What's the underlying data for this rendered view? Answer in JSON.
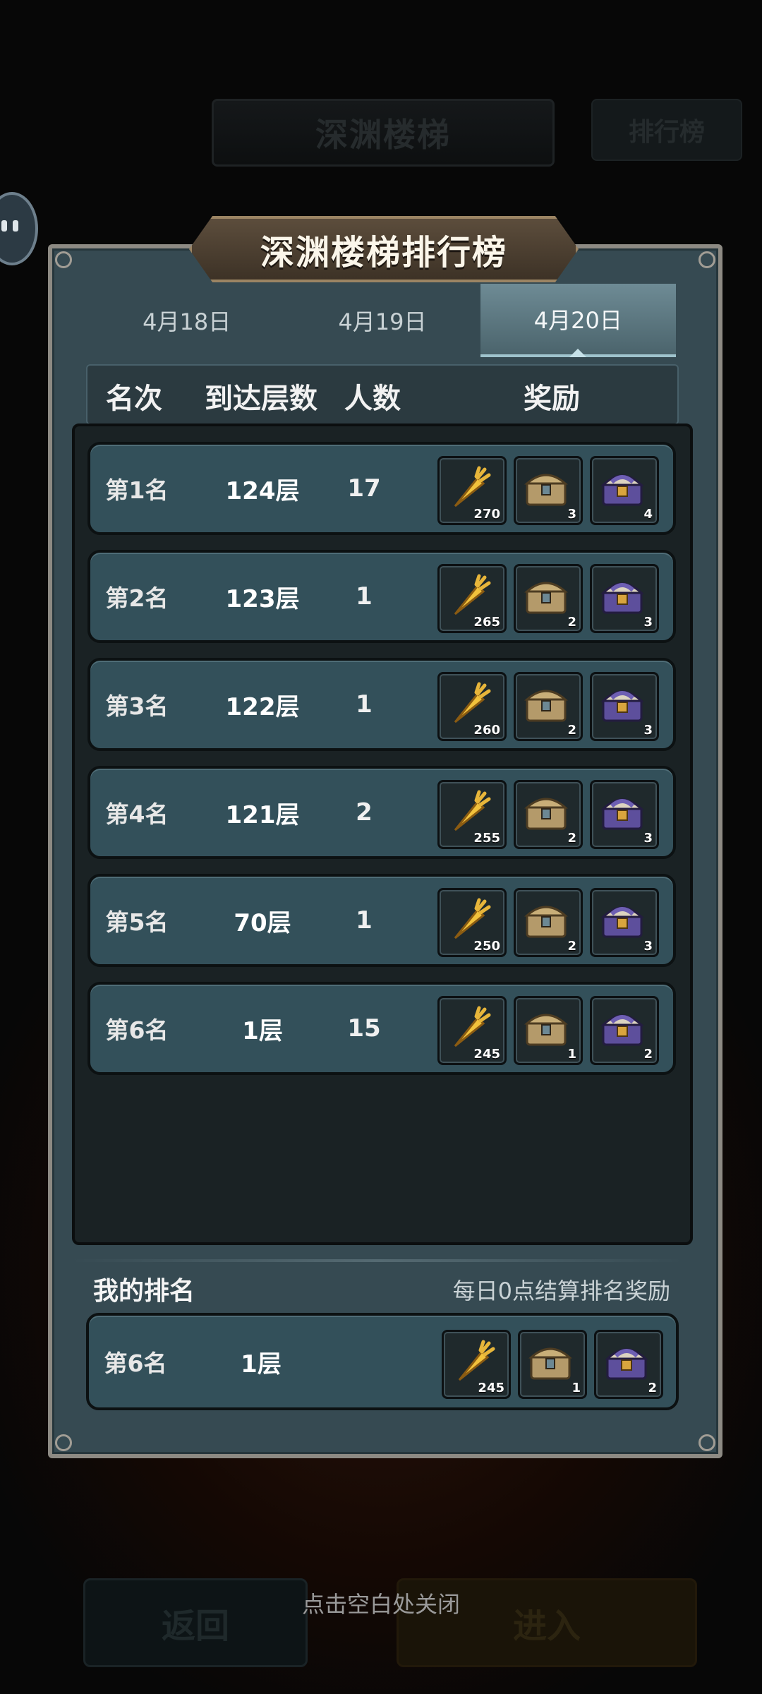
{
  "background": {
    "title": "深渊楼梯",
    "rank_button": "排行榜",
    "back_button": "返回",
    "enter_button": "进入",
    "close_hint": "点击空白处关闭"
  },
  "panel": {
    "title": "深渊楼梯排行榜",
    "tabs": [
      {
        "label": "4月18日",
        "active": false
      },
      {
        "label": "4月19日",
        "active": false
      },
      {
        "label": "4月20日",
        "active": true
      }
    ],
    "columns": {
      "rank": "名次",
      "floor": "到达层数",
      "count": "人数",
      "reward": "奖励"
    },
    "rows": [
      {
        "rank": "第1名",
        "floor": "124层",
        "count": "17",
        "rewards": [
          {
            "icon": "carrot-icon",
            "qty": "270"
          },
          {
            "icon": "gold-chest-icon",
            "qty": "3"
          },
          {
            "icon": "purple-chest-icon",
            "qty": "4"
          }
        ]
      },
      {
        "rank": "第2名",
        "floor": "123层",
        "count": "1",
        "rewards": [
          {
            "icon": "carrot-icon",
            "qty": "265"
          },
          {
            "icon": "gold-chest-icon",
            "qty": "2"
          },
          {
            "icon": "purple-chest-icon",
            "qty": "3"
          }
        ]
      },
      {
        "rank": "第3名",
        "floor": "122层",
        "count": "1",
        "rewards": [
          {
            "icon": "carrot-icon",
            "qty": "260"
          },
          {
            "icon": "gold-chest-icon",
            "qty": "2"
          },
          {
            "icon": "purple-chest-icon",
            "qty": "3"
          }
        ]
      },
      {
        "rank": "第4名",
        "floor": "121层",
        "count": "2",
        "rewards": [
          {
            "icon": "carrot-icon",
            "qty": "255"
          },
          {
            "icon": "gold-chest-icon",
            "qty": "2"
          },
          {
            "icon": "purple-chest-icon",
            "qty": "3"
          }
        ]
      },
      {
        "rank": "第5名",
        "floor": "70层",
        "count": "1",
        "rewards": [
          {
            "icon": "carrot-icon",
            "qty": "250"
          },
          {
            "icon": "gold-chest-icon",
            "qty": "2"
          },
          {
            "icon": "purple-chest-icon",
            "qty": "3"
          }
        ]
      },
      {
        "rank": "第6名",
        "floor": "1层",
        "count": "15",
        "rewards": [
          {
            "icon": "carrot-icon",
            "qty": "245"
          },
          {
            "icon": "gold-chest-icon",
            "qty": "1"
          },
          {
            "icon": "purple-chest-icon",
            "qty": "2"
          }
        ]
      }
    ],
    "my_ranking": {
      "label": "我的排名",
      "note": "每日0点结算排名奖励",
      "rank": "第6名",
      "floor": "1层",
      "rewards": [
        {
          "icon": "carrot-icon",
          "qty": "245"
        },
        {
          "icon": "gold-chest-icon",
          "qty": "1"
        },
        {
          "icon": "purple-chest-icon",
          "qty": "2"
        }
      ]
    }
  },
  "colors": {
    "panel": "#364a52",
    "row": "#33505a",
    "banner": "#5c4d3c",
    "active_tab": "#6e8b95"
  }
}
